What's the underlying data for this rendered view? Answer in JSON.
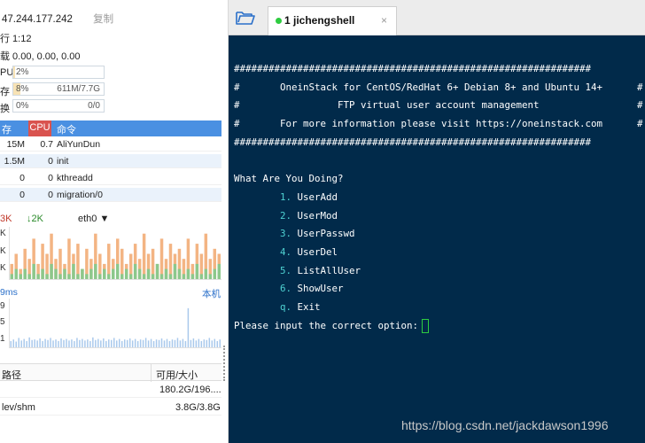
{
  "server": {
    "ip": "47.244.177.242",
    "copy_label": "复制",
    "uptime": "行 1:12",
    "load": "载 0.00, 0.00, 0.00"
  },
  "meters": [
    {
      "label": "PU",
      "pct": "2%",
      "fill": 0.02,
      "value": ""
    },
    {
      "label": "存",
      "pct": "8%",
      "fill": 0.08,
      "value": "611M/7.7G"
    },
    {
      "label": "换",
      "pct": "0%",
      "fill": 0.0,
      "value": "0/0"
    }
  ],
  "processes": {
    "headers": {
      "mem": "存",
      "cpu": "CPU",
      "cmd": "命令"
    },
    "rows": [
      {
        "mem": "15M",
        "cpu": "0.7",
        "name": "AliYunDun"
      },
      {
        "mem": "1.5M",
        "cpu": "0",
        "name": "init"
      },
      {
        "mem": "0",
        "cpu": "0",
        "name": "kthreadd"
      },
      {
        "mem": "0",
        "cpu": "0",
        "name": "migration/0"
      }
    ]
  },
  "network": {
    "up": "3K",
    "down": "↓2K",
    "iface": "eth0 ▼",
    "y_labels": [
      "K",
      "K",
      "K"
    ],
    "chart_data": {
      "type": "bar",
      "series": [
        {
          "values": [
            3,
            5,
            2,
            6,
            4,
            8,
            3,
            7,
            5,
            9,
            4,
            6,
            3,
            8,
            5,
            7,
            2,
            6,
            4,
            9,
            5,
            3,
            7,
            4,
            8,
            6,
            3,
            5,
            7,
            4,
            9,
            5,
            6,
            3,
            8,
            4,
            7,
            5,
            6,
            4,
            8,
            3,
            7,
            5,
            9,
            4,
            6,
            5
          ]
        },
        {
          "values": [
            1,
            2,
            1,
            2,
            1,
            3,
            1,
            2,
            1,
            3,
            2,
            1,
            2,
            1,
            3,
            1,
            2,
            1,
            2,
            3,
            1,
            2,
            1,
            2,
            3,
            1,
            2,
            1,
            3,
            2,
            1,
            2,
            1,
            3,
            1,
            2,
            1,
            3,
            2,
            1,
            2,
            1,
            3,
            1,
            2,
            1,
            2,
            3
          ]
        }
      ]
    }
  },
  "latency": {
    "ms_label": "9ms",
    "link": "本机",
    "y_labels": [
      "9",
      "5",
      "1"
    ],
    "chart_data": {
      "type": "bar",
      "values": [
        1.2,
        1.5,
        1.1,
        1.8,
        1.3,
        1.6,
        1.2,
        1.9,
        1.4,
        1.5,
        1.3,
        1.7,
        1.2,
        1.6,
        1.4,
        1.8,
        1.3,
        1.5,
        1.2,
        1.7,
        1.4,
        1.6,
        1.3,
        1.5,
        1.2,
        1.8,
        1.4,
        1.6,
        1.3,
        1.5,
        1.2,
        1.9,
        1.4,
        1.6,
        1.3,
        1.7,
        1.2,
        1.5,
        1.4,
        1.8,
        1.3,
        1.6,
        1.2,
        1.5,
        1.4,
        1.7,
        1.3,
        1.6,
        1.2,
        1.5,
        1.4,
        1.8,
        1.3,
        1.6,
        1.2,
        1.5,
        1.4,
        1.7,
        1.3,
        1.6,
        1.2,
        1.5,
        1.4,
        1.8,
        1.3,
        1.6,
        1.2,
        7.5,
        1.4,
        1.7,
        1.3,
        1.6,
        1.2,
        1.5,
        1.4,
        1.8,
        1.3,
        1.6,
        1.2,
        1.5
      ]
    }
  },
  "disks": {
    "headers": {
      "path": "路径",
      "avail": "可用/大小"
    },
    "rows": [
      {
        "path": "",
        "avail": "180.2G/196...."
      },
      {
        "path": "lev/shm",
        "avail": "3.8G/3.8G"
      }
    ]
  },
  "tab": {
    "title": "1 jichengshell",
    "close": "×"
  },
  "terminal": {
    "hash_line": "##############################################################",
    "banner": [
      "#       OneinStack for CentOS/RedHat 6+ Debian 8+ and Ubuntu 14+      #",
      "#                 FTP virtual user account management                 #",
      "#       For more information please visit https://oneinstack.com      #"
    ],
    "question": "What Are You Doing?",
    "options": [
      {
        "key": "1.",
        "label": "UserAdd"
      },
      {
        "key": "2.",
        "label": "UserMod"
      },
      {
        "key": "3.",
        "label": "UserPasswd"
      },
      {
        "key": "4.",
        "label": "UserDel"
      },
      {
        "key": "5.",
        "label": "ListAllUser"
      },
      {
        "key": "6.",
        "label": "ShowUser"
      },
      {
        "key": "q.",
        "label": "Exit"
      }
    ],
    "prompt": "Please input the correct option:"
  },
  "watermark": "https://blog.csdn.net/jackdawson1996"
}
